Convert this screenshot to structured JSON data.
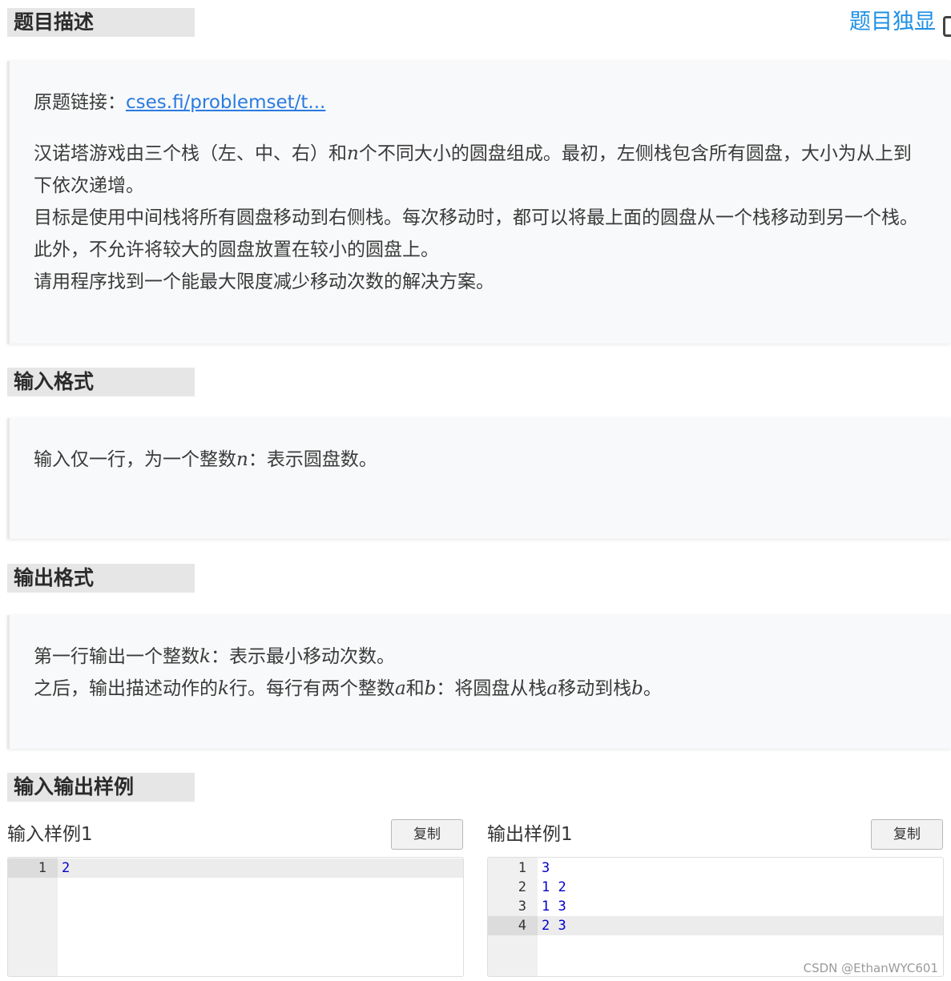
{
  "description": {
    "title": "题目描述",
    "solo_link": "题目独显",
    "source_label": "原题链接：",
    "source_link": "cses.fi/problemset/t...",
    "para1_a": "汉诺塔游戏由三个栈（左、中、右）和",
    "para1_var": "n",
    "para1_b": "个不同大小的圆盘组成。最初，左侧栈包含所有圆盘，大小为从上到下依次递增。",
    "para2": "目标是使用中间栈将所有圆盘移动到右侧栈。每次移动时，都可以将最上面的圆盘从一个栈移动到另一个栈。此外，不允许将较大的圆盘放置在较小的圆盘上。",
    "para3": "请用程序找到一个能最大限度减少移动次数的解决方案。"
  },
  "input_format": {
    "title": "输入格式",
    "text_a": "输入仅一行，为一个整数",
    "var": "n",
    "text_b": "：表示圆盘数。"
  },
  "output_format": {
    "title": "输出格式",
    "line1_a": "第一行输出一个整数",
    "line1_var": "k",
    "line1_b": "：表示最小移动次数。",
    "line2_a": "之后，输出描述动作的",
    "line2_var1": "k",
    "line2_b": "行。每行有两个整数",
    "line2_var2": "a",
    "line2_c": "和",
    "line2_var3": "b",
    "line2_d": "：将圆盘从栈",
    "line2_var4": "a",
    "line2_e": "移动到栈",
    "line2_var5": "b",
    "line2_f": "。"
  },
  "samples": {
    "title": "输入输出样例",
    "input": {
      "label": "输入样例1",
      "copy": "复制",
      "lines": [
        {
          "n": "1",
          "code": "2"
        }
      ]
    },
    "output": {
      "label": "输出样例1",
      "copy": "复制",
      "lines": [
        {
          "n": "1",
          "code": "3"
        },
        {
          "n": "2",
          "code": "1 2"
        },
        {
          "n": "3",
          "code": "1 3"
        },
        {
          "n": "4",
          "code": "2 3"
        }
      ]
    }
  },
  "watermark": "CSDN @EthanWYC601",
  "colors": {
    "link": "#1e90e6",
    "code": "#0000cc",
    "header_bg": "#e6e6e6",
    "card_bg": "#f8f9fa"
  }
}
